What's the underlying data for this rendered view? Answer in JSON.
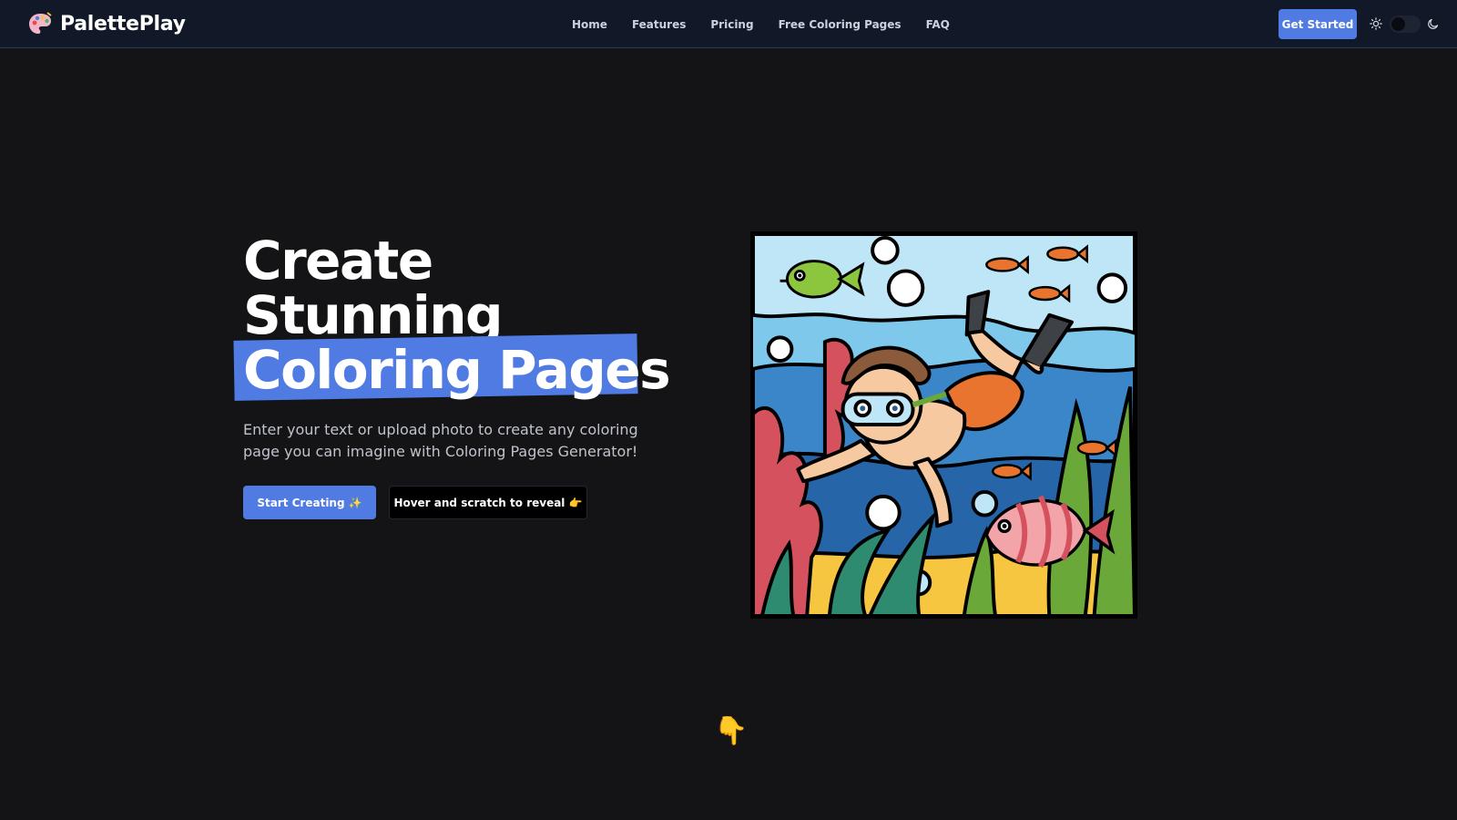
{
  "brand": {
    "name": "PalettePlay",
    "logo_icon": "palette-icon"
  },
  "nav": {
    "links": [
      "Home",
      "Features",
      "Pricing",
      "Free Coloring Pages",
      "FAQ"
    ],
    "cta_label": "Get Started",
    "theme_toggle": {
      "light_icon": "sun-icon",
      "dark_icon": "moon-icon",
      "state": "dark"
    }
  },
  "hero": {
    "title_line1": "Create",
    "title_line2": "Stunning",
    "title_highlight": "Coloring Pages",
    "subtitle": "Enter your text or upload photo to create any coloring page you can imagine with Coloring Pages Generator!",
    "primary_button": "Start Creating ✨",
    "secondary_button": "Hover and scratch to reveal 👉",
    "image_subject": "underwater-diver-coloring-illustration",
    "scroll_hint": "👇"
  },
  "colors": {
    "background": "#141416",
    "nav_background": "#111827",
    "accent": "#4f7be3"
  }
}
